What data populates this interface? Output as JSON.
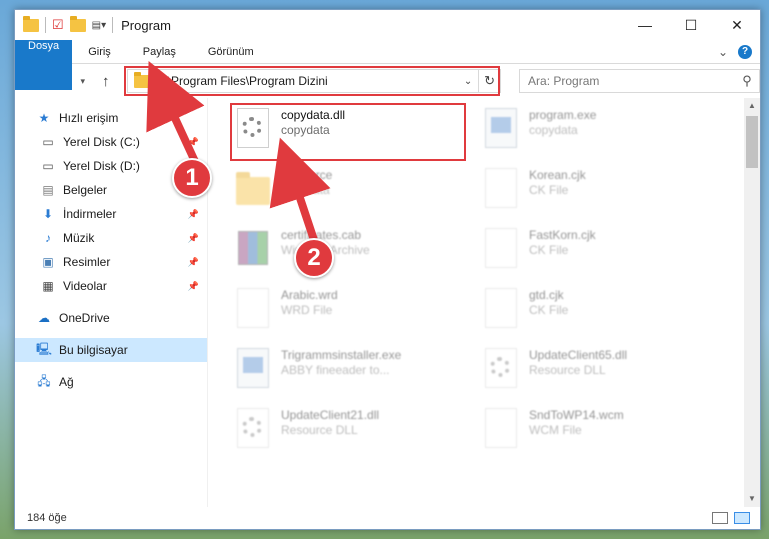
{
  "window": {
    "title": "Program"
  },
  "ribbon": {
    "tabs": [
      "Dosya",
      "Giriş",
      "Paylaş",
      "Görünüm"
    ]
  },
  "address": {
    "path": "C:\\Program Files\\Program Dizini"
  },
  "search": {
    "placeholder": "Ara: Program"
  },
  "sidebar": {
    "items": [
      {
        "label": "Hızlı erişim",
        "icon": "star-icon"
      },
      {
        "label": "Yerel Disk (C:)",
        "icon": "drive-icon"
      },
      {
        "label": "Yerel Disk (D:)",
        "icon": "drive-icon"
      },
      {
        "label": "Belgeler",
        "icon": "documents-icon"
      },
      {
        "label": "İndirmeler",
        "icon": "download-icon"
      },
      {
        "label": "Müzik",
        "icon": "music-icon"
      },
      {
        "label": "Resimler",
        "icon": "pictures-icon"
      },
      {
        "label": "Videolar",
        "icon": "video-icon"
      },
      {
        "label": "OneDrive",
        "icon": "cloud-icon"
      },
      {
        "label": "Bu bilgisayar",
        "icon": "computer-icon"
      },
      {
        "label": "Ağ",
        "icon": "network-icon"
      }
    ]
  },
  "files": [
    {
      "name": "copydata.dll",
      "sub": "copydata",
      "type": "dll"
    },
    {
      "name": "program.exe",
      "sub": "copydata",
      "type": "exe"
    },
    {
      "name": "Resource",
      "sub": "copydata",
      "type": "folder"
    },
    {
      "name": "Korean.cjk",
      "sub": "CK File",
      "type": "doc"
    },
    {
      "name": "certificates.cab",
      "sub": "WinRAR Archive",
      "type": "rar"
    },
    {
      "name": "FastKorn.cjk",
      "sub": "CK File",
      "type": "doc"
    },
    {
      "name": "Arabic.wrd",
      "sub": "WRD File",
      "type": "doc"
    },
    {
      "name": "gtd.cjk",
      "sub": "CK File",
      "type": "doc"
    },
    {
      "name": "Trigrammsinstaller.exe",
      "sub": "ABBY fineeader to...",
      "type": "exe"
    },
    {
      "name": "UpdateClient65.dll",
      "sub": "Resource DLL",
      "type": "dll"
    },
    {
      "name": "UpdateClient21.dll",
      "sub": "Resource DLL",
      "type": "dll"
    },
    {
      "name": "SndToWP14.wcm",
      "sub": "WCM File",
      "type": "doc"
    }
  ],
  "status": {
    "count": "184 öğe"
  },
  "markers": {
    "one": "1",
    "two": "2"
  }
}
